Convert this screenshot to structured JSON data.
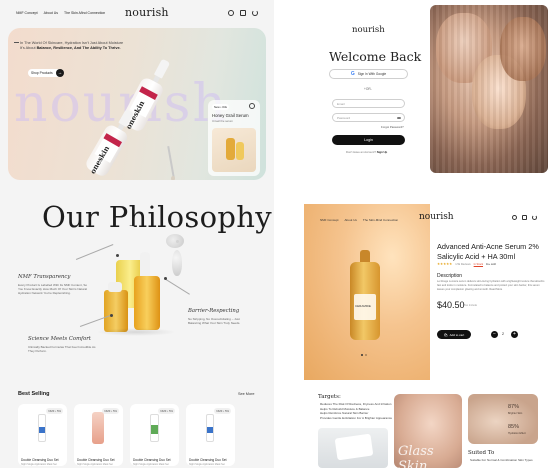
{
  "left": {
    "nav": {
      "links": [
        "NMF Concept",
        "About Us",
        "The Skin-Mind Connection"
      ],
      "brand": "nourish"
    },
    "hero": {
      "text_plain": "In The World Of Skincare, Hydration Isn't Just About Moisture It's About ",
      "text_bold": "Balance, Resilience, And The Ability To Thrive.",
      "cta": "Shop Products",
      "watermark": "nourish",
      "bottle_label": "oneskin",
      "feature_tag": "New • Oils",
      "feature_title": "Honey Grail Serum",
      "feature_sub": "Unveil the serum"
    },
    "philosophy": {
      "title": "Our Philosophy",
      "items": [
        {
          "heading": "NMF Transparency",
          "body": "Every Product Is Labelled With Its NMF Content, So You Know Exactly How Much Of Your Skin's Natural Hydration Network You're Replenishing."
        },
        {
          "heading": "Barrier-Respecting",
          "body": "No Stripping, No Overexfoliating – Just Balancing What Your Skin Truly Needs."
        },
        {
          "heading": "Science Meets Comfort",
          "body": "Clinically Backed Formulas That Feel Incredible As They Perform."
        }
      ]
    },
    "best_selling": {
      "title": "Best Selling",
      "see_more": "See More",
      "cards": [
        {
          "tag": "NMF • 5%",
          "name": "Double Cleansing Duo Set",
          "sub": "Night Single Application Mask Set",
          "accent": "#3a73c9"
        },
        {
          "tag": "NMF • 5%",
          "name": "Double Cleansing Duo Set",
          "sub": "Night Single Application Mask Set",
          "accent": "#e7a08a"
        },
        {
          "tag": "NMF • 5%",
          "name": "Double Cleansing Duo Set",
          "sub": "Night Single Application Mask Set",
          "accent": "#5faa57"
        },
        {
          "tag": "NMF • 5%",
          "name": "Double Cleansing Duo Set",
          "sub": "Night Single Application Mask Set",
          "accent": "#3a73c9"
        }
      ]
    }
  },
  "login": {
    "brand": "nourish",
    "title": "Welcome Back",
    "google_button": "Sign In With Google",
    "divider": "+OR-",
    "email_placeholder": "Email",
    "password_placeholder": "Password",
    "forgot": "Forgot Password?",
    "login_button": "Login",
    "signup_prompt": "Don't Have an Account?",
    "signup_link": "Sign Up"
  },
  "product": {
    "nav": {
      "links": [
        "NMF Concept",
        "About Us",
        "The Skin-Mind Connection"
      ],
      "brand": "nourish"
    },
    "title": "Advanced Anti-Acne Serum 2% Salicylic Acid + HA 30ml",
    "rating_text": "1.5k Reviews",
    "stock": "In Stock",
    "sold": "1k+ sold",
    "description_heading": "Description",
    "description": "Le Rouge Lumiere serum delivers skin-loving hydration with a lightweight texture that absorbs fast and locks in moisture. Formulated to balance and protect your skin barrier, this serum leaves your complexion glowing and smooth. Read More",
    "price": "$40.50",
    "tax_note": "Tax Include",
    "add_to_cart": "Add to cart",
    "quantity": "2",
    "bottle_label": "CERAMIDE",
    "targets_heading": "Targets:",
    "targets": [
      "Reduces The Risk Of Redness, Dryness And Irritation",
      "Helps To Rebuild Moisture & Balance",
      "Helps Reinforce Natural Skin Barrier",
      "Provides Gentle Exfoliation For A Brighter Appearance"
    ],
    "stat1_value": "87%",
    "stat1_label": "Brighter Skin",
    "stat2_value": "85%",
    "stat2_label": "Hydration Effect",
    "promo_word": "Glass Skin",
    "suited_heading": "Suited To",
    "suited": [
      "Suitable For Normal & Combination Skin Types"
    ]
  }
}
